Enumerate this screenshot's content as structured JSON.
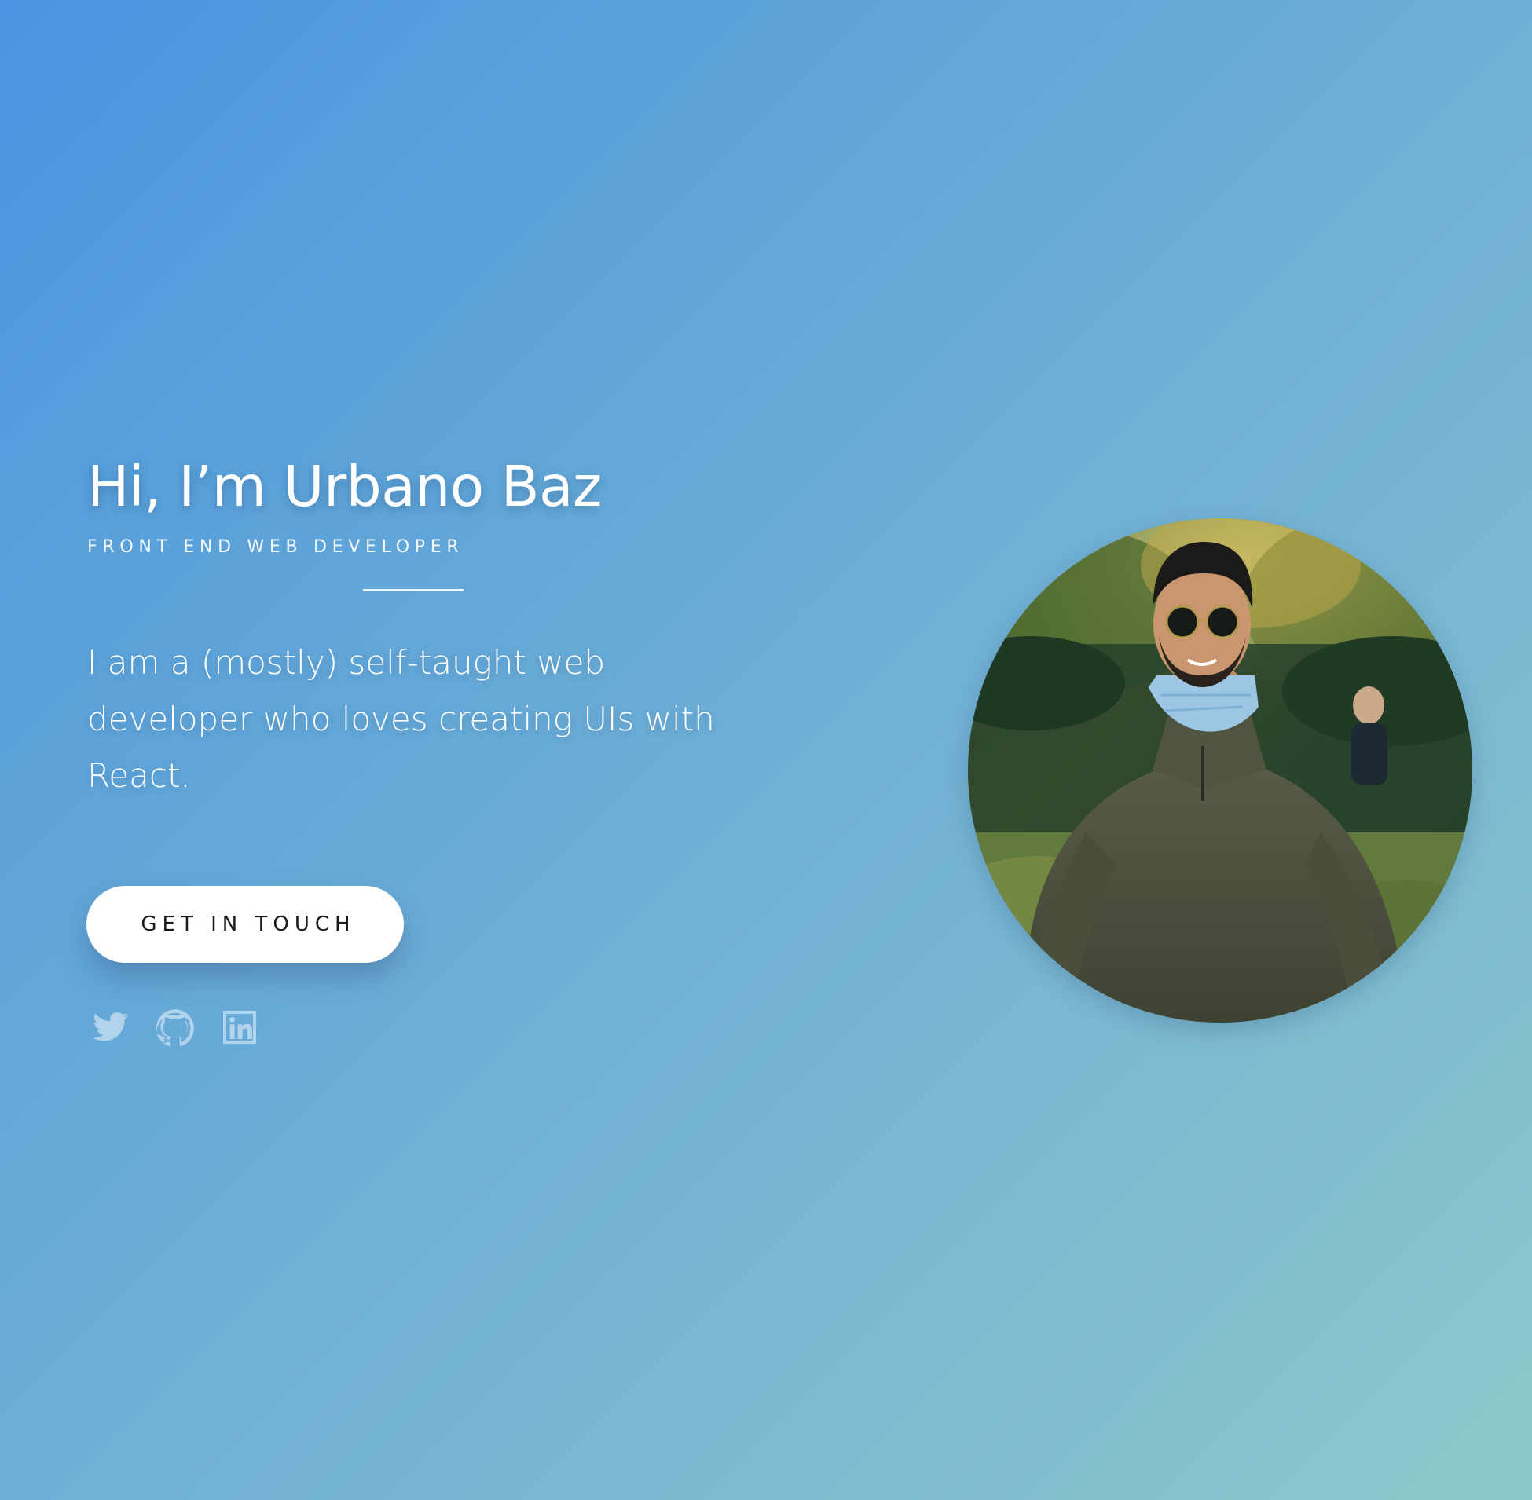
{
  "hero": {
    "title": "Hi, I’m Urbano Baz",
    "subtitle": "FRONT END WEB DEVELOPER",
    "bio": "I am a (mostly) self-taught web developer who loves creating UIs with React.",
    "cta_label": "GET IN TOUCH"
  },
  "social": {
    "items": [
      {
        "name": "twitter",
        "icon": "twitter-icon"
      },
      {
        "name": "github",
        "icon": "github-icon"
      },
      {
        "name": "linkedin",
        "icon": "linkedin-icon"
      }
    ]
  },
  "portrait": {
    "alt": "Urbano Baz"
  },
  "colors": {
    "gradient_start": "#4a94e1",
    "gradient_end": "#8cc8ca",
    "button_bg": "#ffffff",
    "button_text": "#1b1b1b",
    "icon_color": "#b9d7ee"
  }
}
